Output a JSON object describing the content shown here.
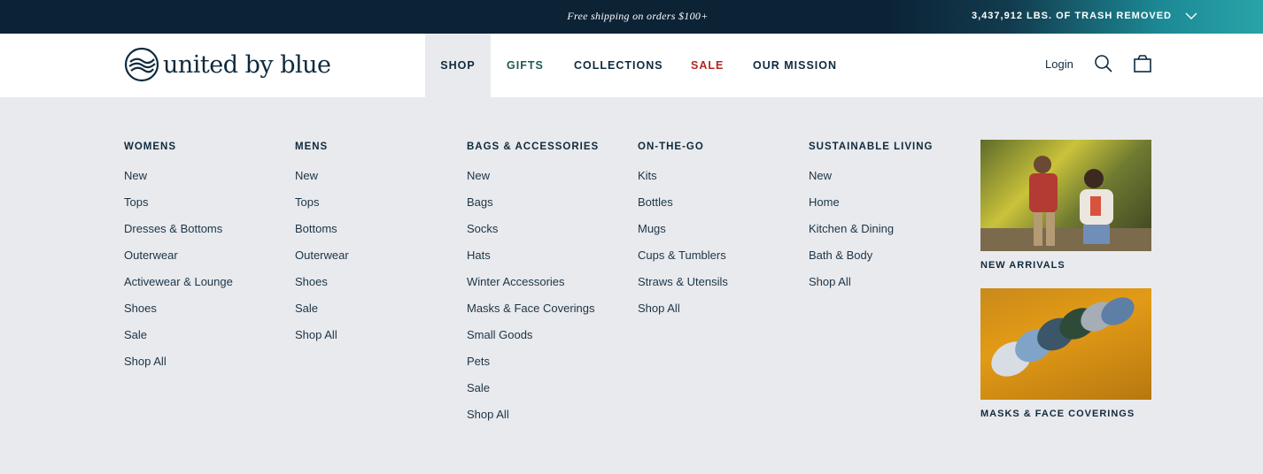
{
  "topbar": {
    "promo": "Free shipping on orders $100+",
    "trash_counter": "3,437,912 LBS. OF TRASH REMOVED"
  },
  "brand": {
    "name": "united by blue"
  },
  "nav": {
    "shop": "SHOP",
    "gifts": "GIFTS",
    "collections": "COLLECTIONS",
    "sale": "SALE",
    "mission": "OUR MISSION"
  },
  "header": {
    "login": "Login"
  },
  "menu": {
    "columns": [
      {
        "title": "WOMENS",
        "items": [
          "New",
          "Tops",
          "Dresses & Bottoms",
          "Outerwear",
          "Activewear & Lounge",
          "Shoes",
          "Sale",
          "Shop All"
        ]
      },
      {
        "title": "MENS",
        "items": [
          "New",
          "Tops",
          "Bottoms",
          "Outerwear",
          "Shoes",
          "Sale",
          "Shop All"
        ]
      },
      {
        "title": "BAGS & ACCESSORIES",
        "items": [
          "New",
          "Bags",
          "Socks",
          "Hats",
          "Winter Accessories",
          "Masks & Face Coverings",
          "Small Goods",
          "Pets",
          "Sale",
          "Shop All"
        ]
      },
      {
        "title": "ON-THE-GO",
        "items": [
          "Kits",
          "Bottles",
          "Mugs",
          "Cups & Tumblers",
          "Straws & Utensils",
          "Shop All"
        ]
      },
      {
        "title": "SUSTAINABLE LIVING",
        "items": [
          "New",
          "Home",
          "Kitchen & Dining",
          "Bath & Body",
          "Shop All"
        ]
      }
    ],
    "promos": [
      {
        "label": "NEW ARRIVALS"
      },
      {
        "label": "MASKS & FACE COVERINGS"
      }
    ]
  },
  "colors": {
    "topbar_bg": "#0c2235",
    "topbar_accent": "#2aa3a8",
    "text_dark": "#0f2a3d",
    "gifts": "#1d5a55",
    "sale": "#b3261e",
    "menu_bg": "#e9eaee"
  },
  "icons": [
    "chevron-down-icon",
    "logo-waves-icon",
    "search-icon",
    "shopping-bag-icon"
  ]
}
